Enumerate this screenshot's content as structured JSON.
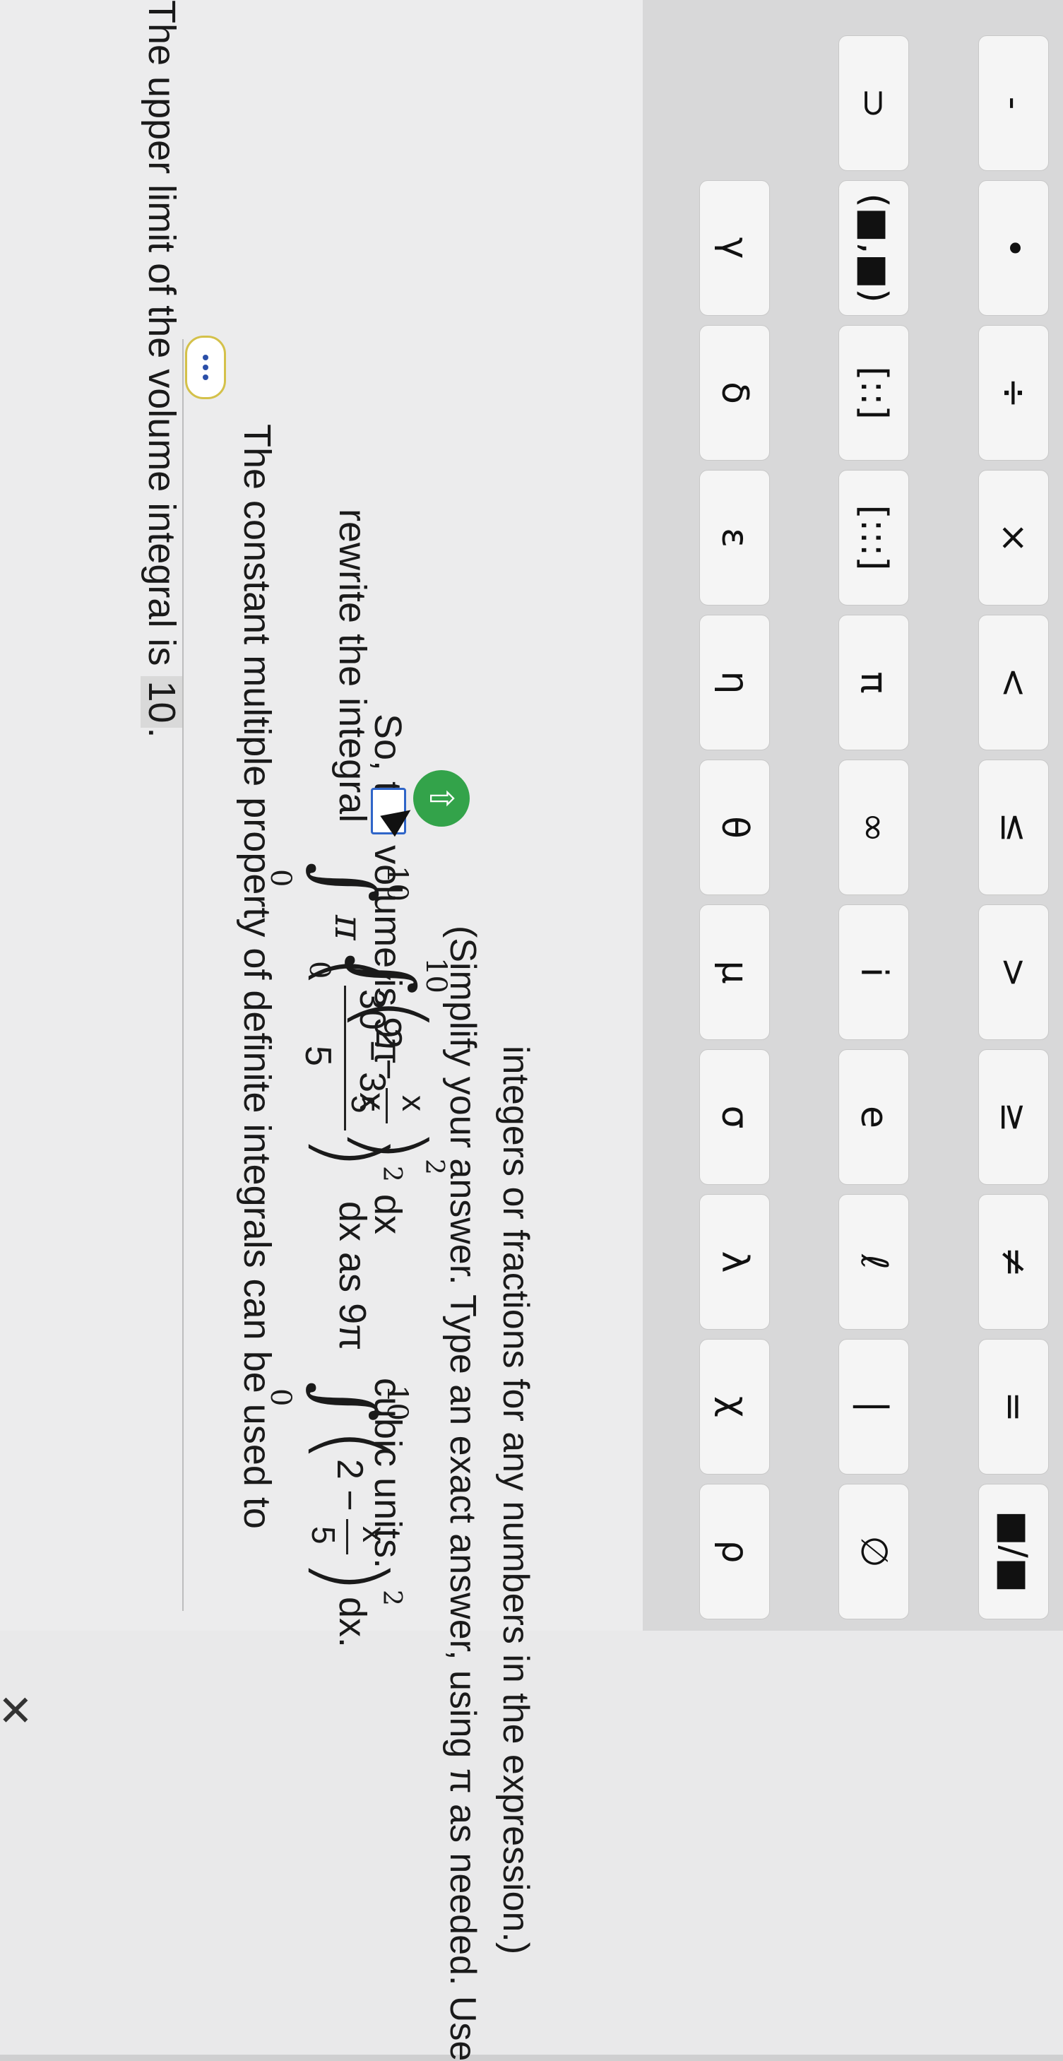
{
  "header": {
    "top_line_prefix": "The upper limit of the volume integral is",
    "top_line_value": "10",
    "top_line_suffix": "."
  },
  "line1": "The constant multiple property of definite integrals can be used to",
  "line2": {
    "prefix": "rewrite the integral",
    "pi": "π",
    "upper": "10",
    "lower": "0",
    "numer": "30 − 3x",
    "denom": "5",
    "exp": "2",
    "mid": "dx as 9π",
    "inner": "2 −",
    "frac_num": "x",
    "frac_den": "5",
    "end": "dx."
  },
  "line3": {
    "prefix": "So, the volume is 9π",
    "upper": "10",
    "lower": "0",
    "inner": "2 −",
    "frac_num": "x",
    "frac_den": "5",
    "exp": "2",
    "dx": "dx",
    "suffix": "cubic units."
  },
  "line4": "(Simplify your answer. Type an exact answer, using π as needed. Use",
  "line5": "integers or fractions for any numbers in the expression.)",
  "icons": {
    "dots": "more-icon",
    "upload": "arrow-up-icon",
    "cursor": "cursor-icon",
    "close": "close-icon"
  },
  "keyboard": {
    "row1": [
      "■/■",
      "=",
      "≠",
      "≥",
      ">",
      "≤",
      "<",
      "×",
      "÷",
      "•",
      "-"
    ],
    "row2": [
      "∅",
      "|",
      "ℓ",
      "e",
      "i",
      "∞",
      "π",
      "[:::]",
      "[::]",
      "(■,■)",
      "⊃"
    ],
    "row3": [
      "ρ",
      "χ",
      "λ",
      "σ",
      "μ",
      "θ",
      "η",
      "ε",
      "δ",
      "γ"
    ]
  },
  "close_label": "✕"
}
